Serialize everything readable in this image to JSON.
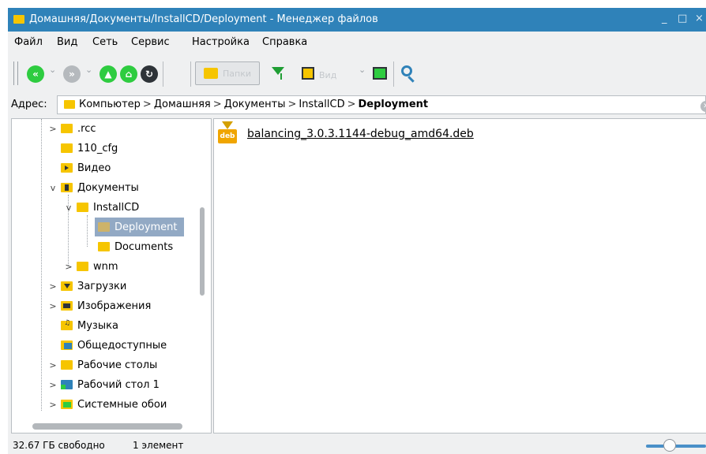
{
  "window": {
    "title": "Домашняя/Документы/InstallCD/Deployment - Менеджер файлов",
    "minimize_glyph": "_",
    "maximize_glyph": "□",
    "close_glyph": "×"
  },
  "menu": {
    "items": [
      {
        "label": "Файл"
      },
      {
        "label": "Вид"
      },
      {
        "label": "Сеть"
      },
      {
        "label": "Сервис"
      },
      {
        "label": "Настройка"
      },
      {
        "label": "Справка"
      }
    ]
  },
  "toolbar": {
    "tree_toggle_label": "Папки",
    "view_label": "Вид",
    "icons": [
      "back-icon",
      "forward-icon",
      "up-icon",
      "home-icon",
      "reload-icon",
      "folder-tree-icon",
      "filter-icon",
      "view-mode-icon",
      "split-view-icon",
      "search-icon"
    ],
    "colors": {
      "green": "#2ecc40",
      "green_dark": "#1f9e34",
      "gray": "#b5b9bd",
      "dark": "#2e3338",
      "folder": "#f6c500",
      "search": "#2f82b9"
    }
  },
  "address": {
    "label": "Адрес:",
    "crumbs": [
      "Компьютер",
      "Домашняя",
      "Документы",
      "InstallCD"
    ],
    "current": "Deployment",
    "separator": ">"
  },
  "tree": {
    "items": [
      {
        "label": ".rcc",
        "expander": ">",
        "icon": "folder-icon"
      },
      {
        "label": "110_cfg",
        "expander": "",
        "icon": "folder-icon"
      },
      {
        "label": "Видео",
        "expander": "",
        "icon": "videos-folder-icon"
      },
      {
        "label": "Документы",
        "expander": "v",
        "icon": "documents-folder-icon"
      },
      {
        "label": "InstallCD",
        "expander": "v",
        "icon": "folder-icon"
      },
      {
        "label": "Deployment",
        "expander": "",
        "icon": "folder-icon"
      },
      {
        "label": "Documents",
        "expander": "",
        "icon": "folder-icon"
      },
      {
        "label": "wnm",
        "expander": ">",
        "icon": "folder-icon"
      },
      {
        "label": "Загрузки",
        "expander": ">",
        "icon": "downloads-folder-icon"
      },
      {
        "label": "Изображения",
        "expander": ">",
        "icon": "pictures-folder-icon"
      },
      {
        "label": "Музыка",
        "expander": "",
        "icon": "music-folder-icon"
      },
      {
        "label": "Общедоступные",
        "expander": "",
        "icon": "public-folder-icon"
      },
      {
        "label": "Рабочие столы",
        "expander": ">",
        "icon": "folder-icon"
      },
      {
        "label": "Рабочий стол 1",
        "expander": ">",
        "icon": "desktop-folder-icon"
      },
      {
        "label": "Системные обои",
        "expander": ">",
        "icon": "wallpapers-folder-icon"
      }
    ],
    "selected": "Deployment"
  },
  "files": {
    "items": [
      {
        "name": "balancing_3.0.3.1144-debug_amd64.deb",
        "icon": "deb-package-icon",
        "badge": "deb"
      }
    ]
  },
  "status": {
    "free_space": "32.67 ГБ свободно",
    "item_count": "1 элемент"
  }
}
